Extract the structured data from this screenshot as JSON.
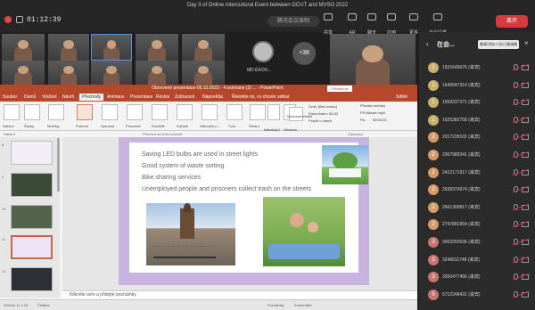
{
  "window": {
    "title": "Day 3 of Online Intercultural Event between GCUT and MVSO 2022",
    "timer": "01:12:39",
    "meeting_id": "腾讯会议录制"
  },
  "toolbar": {
    "items": [
      {
        "label": "共享"
      },
      {
        "label": "AR"
      },
      {
        "label": "聊天"
      },
      {
        "label": "应用"
      },
      {
        "label": "会议设置"
      },
      {
        "label": "更多"
      }
    ],
    "leave": "离开"
  },
  "video": {
    "self_name": "MD ÉKOV...",
    "more_count": "+38"
  },
  "ppt": {
    "title": "Obnovené prezentace-05.10.2022 - 4.oslovane (2) ... - PowerPoint",
    "account": "Přihlásit se",
    "tabs": [
      "Soubor",
      "Domů",
      "Vložení",
      "Návrh",
      "Přechody",
      "Animace",
      "Prezentace",
      "Revize",
      "Zobrazení",
      "Nápověda",
      "Řekněte mi, co chcete udělat",
      "Sdílet"
    ],
    "ribbon": {
      "buttons": [
        "Náhled",
        "Žádný",
        "Morfing",
        "Prolnutí",
        "Vysunutí",
        "Posuvník",
        "Rozdělit",
        "Odhalit",
        "Náhodné p...",
        "Tvar",
        "Stírání",
        "Nabalující",
        "Obrazce",
        "Možnosti efektu"
      ],
      "sound": "Zvuk: [Bez zvuku]",
      "duration": "Doba trvání: 00,50",
      "apply_all": "Použít u všech",
      "advance_title": "Předání snímku",
      "on_click": "Při kliknutí myší",
      "after": "Po:",
      "after_value": "00:00,00"
    },
    "groups": [
      "Náhled",
      "Přechod na tento snímek",
      "Časování"
    ],
    "slide_numbers": [
      "8",
      "9",
      "10",
      "11",
      "12"
    ],
    "bullets": [
      "Saving LED bulbs are used in street lights",
      "Good system of waste sorting",
      "Bike sharing services",
      "Unemployed people and prisoners collect trash on the streets"
    ],
    "notes": "Klikněte sem a přidejte poznámky",
    "status_left": "Snímek 11 z 24",
    "status_lang": "Čeština",
    "status_right": [
      "Poznámky",
      "Komentáře"
    ]
  },
  "participants": {
    "title": "在会...",
    "invite": "邀请/添加人员/已邀请邀请",
    "list": [
      {
        "name": "1531649676 (来宾)",
        "color": "#c9b06c",
        "initial": "1"
      },
      {
        "name": "1640047314 (来宾)",
        "color": "#c9b06c",
        "initial": "1"
      },
      {
        "name": "1659237371 (来宾)",
        "color": "#c9b06c",
        "initial": "1"
      },
      {
        "name": "1625382758 (来宾)",
        "color": "#c9b06c",
        "initial": "1"
      },
      {
        "name": "2017228102 (来宾)",
        "color": "#d69b6a",
        "initial": "2"
      },
      {
        "name": "2067985341 (来宾)",
        "color": "#d69b6a",
        "initial": "2"
      },
      {
        "name": "2412171917 (来宾)",
        "color": "#d69b6a",
        "initial": "2"
      },
      {
        "name": "2638374974 (来宾)",
        "color": "#d69b6a",
        "initial": "2"
      },
      {
        "name": "2661300817 (来宾)",
        "color": "#d69b6a",
        "initial": "2"
      },
      {
        "name": "2747881954 (来宾)",
        "color": "#d69b6a",
        "initial": "2"
      },
      {
        "name": "3063250536 (来宾)",
        "color": "#c97474",
        "initial": "3"
      },
      {
        "name": "3246811748 (来宾)",
        "color": "#c97474",
        "initial": "3"
      },
      {
        "name": "3350477456 (来宾)",
        "color": "#c97474",
        "initial": "3"
      },
      {
        "name": "5712248431 (来宾)",
        "color": "#c97474",
        "initial": "5"
      }
    ]
  }
}
